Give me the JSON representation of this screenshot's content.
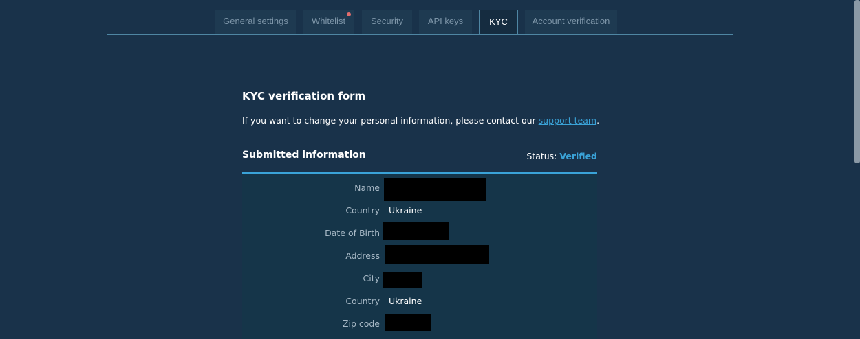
{
  "tabs": [
    {
      "label": "General settings"
    },
    {
      "label": "Whitelist"
    },
    {
      "label": "Security"
    },
    {
      "label": "API keys"
    },
    {
      "label": "KYC"
    },
    {
      "label": "Account verification"
    }
  ],
  "active_tab": "KYC",
  "kyc": {
    "title": "KYC verification form",
    "note_text": "If you want to change your personal information, please contact our ",
    "note_link": "support team",
    "note_end": ".",
    "submitted_title": "Submitted information",
    "status_label": "Status:",
    "status_value": "Verified",
    "fields": [
      {
        "label": "Name",
        "value": "",
        "redacted": true
      },
      {
        "label": "Country",
        "value": "Ukraine",
        "redacted": false
      },
      {
        "label": "Date of Birth",
        "value": "",
        "redacted": true
      },
      {
        "label": "Address",
        "value": "",
        "redacted": true
      },
      {
        "label": "City",
        "value": "",
        "redacted": true
      },
      {
        "label": "Country",
        "value": "Ukraine",
        "redacted": false
      },
      {
        "label": "Zip code",
        "value": "",
        "redacted": true
      }
    ]
  },
  "colors": {
    "background": "#19324a",
    "accent": "#3aa3d8",
    "notification_dot": "#e26d6d"
  }
}
